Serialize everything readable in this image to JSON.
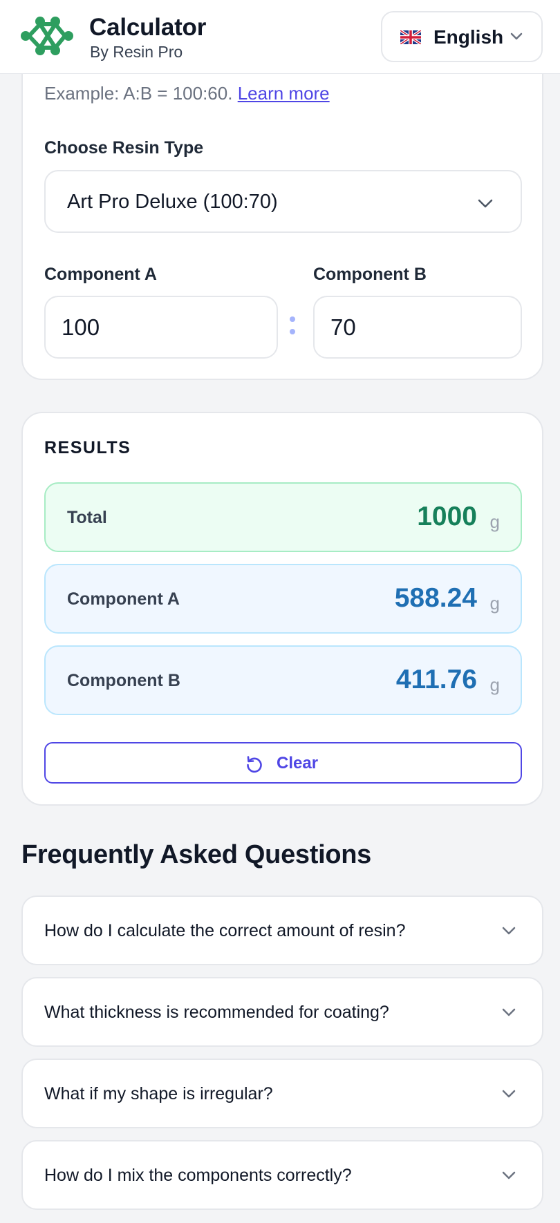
{
  "header": {
    "title": "Calculator",
    "subtitle": "By Resin Pro",
    "language": {
      "flag_icon": "uk-flag-icon",
      "label": "English"
    }
  },
  "calculator": {
    "hint_text": "Example: A:B = 100:60. ",
    "hint_link": "Learn more",
    "resin_type_label": "Choose Resin Type",
    "resin_type_value": "Art Pro Deluxe (100:70)",
    "component_a_label": "Component A",
    "component_b_label": "Component B",
    "component_a_value": "100",
    "component_b_value": "70"
  },
  "results": {
    "title": "RESULTS",
    "rows": [
      {
        "label": "Total",
        "value": "1000",
        "unit": "g"
      },
      {
        "label": "Component A",
        "value": "588.24",
        "unit": "g"
      },
      {
        "label": "Component B",
        "value": "411.76",
        "unit": "g"
      }
    ],
    "clear_label": "Clear"
  },
  "faq": {
    "title": "Frequently Asked Questions",
    "items": [
      {
        "question": "How do I calculate the correct amount of resin?"
      },
      {
        "question": "What thickness is recommended for coating?"
      },
      {
        "question": "What if my shape is irregular?"
      },
      {
        "question": "How do I mix the components correctly?"
      }
    ]
  },
  "colors": {
    "brand_green": "#2e9e5f",
    "accent_indigo": "#4f46e5",
    "total_green": "#16805a",
    "component_blue": "#1f6fb3"
  }
}
